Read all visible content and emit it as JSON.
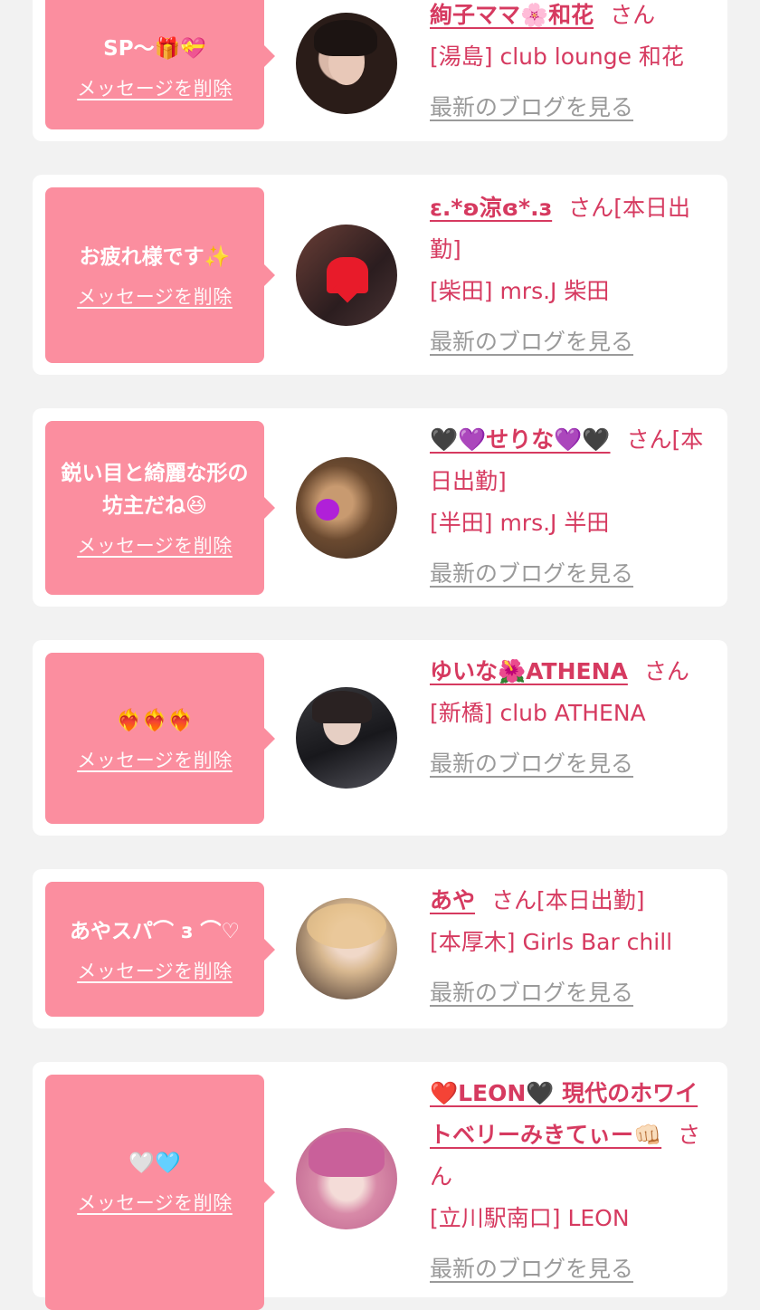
{
  "delete_label": "メッセージを削除",
  "blog_label": "最新のブログを見る",
  "colors": {
    "bubble": "#fb8e9f",
    "accent": "#d63a60",
    "link_gray": "#9a9a9a",
    "background": "#f2f2f2"
  },
  "cards": [
    {
      "message": "SP〜🎁💝",
      "name": "絢子ママ🌸和花",
      "honorific": "さん",
      "status": "",
      "shop": "[湯島] club lounge 和花"
    },
    {
      "message": "お疲れ様です✨",
      "name": "ε.*ʚ涼ɞ*.з",
      "honorific": "さん",
      "status": "[本日出勤]",
      "shop": "[柴田] mrs.J 柴田"
    },
    {
      "message": "鋭い目と綺麗な形の坊主だね😆",
      "name": "🖤💜せりな💜🖤",
      "honorific": "さん",
      "status": "[本日出勤]",
      "shop": "[半田] mrs.J 半田"
    },
    {
      "message": "❤️‍🔥❤️‍🔥❤️‍🔥",
      "name": "ゆいな🌺ATHENA",
      "honorific": "さん",
      "status": "",
      "shop": "[新橋] club ATHENA"
    },
    {
      "message": "あやスパ⌒ з ⌒♡",
      "name": "あや",
      "honorific": "さん",
      "status": "[本日出勤]",
      "shop": "[本厚木] Girls Bar chill"
    },
    {
      "message": "🤍🩵",
      "name": "❤️LEON🖤 現代のホワイトベリーみきてぃー👊🏻",
      "honorific": "さん",
      "status": "",
      "shop": "[立川駅南口] LEON"
    }
  ]
}
